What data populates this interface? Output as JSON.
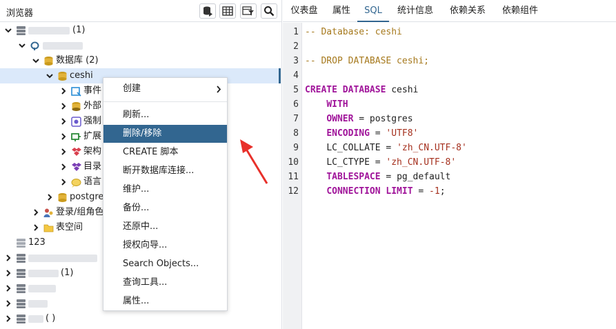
{
  "browser": {
    "title": "浏览器",
    "tree": {
      "server_group_suffix": "(1)",
      "databases_label": "数据库 (2)",
      "db_ceshi": "ceshi",
      "events": "事件",
      "foreign": "外部",
      "force": "强制",
      "extensions": "扩展",
      "schemas": "架构",
      "catalogs": "目录",
      "languages": "语言",
      "db_postgres": "postgres",
      "login_roles": "登录/组角色",
      "tablespaces": "表空间",
      "group_123": "123",
      "group_s_suffix": "(1)",
      "group_last_suffix": "( )"
    }
  },
  "context_menu": {
    "items": [
      {
        "label": "创建",
        "has_submenu": true
      },
      {
        "label": "刷新..."
      },
      {
        "label": "删除/移除",
        "active": true
      },
      {
        "label": "CREATE 脚本"
      },
      {
        "label": "断开数据库连接..."
      },
      {
        "label": "维护..."
      },
      {
        "label": "备份..."
      },
      {
        "label": "还原中..."
      },
      {
        "label": "授权向导..."
      },
      {
        "label": "Search Objects..."
      },
      {
        "label": "查询工具..."
      },
      {
        "label": "属性..."
      }
    ]
  },
  "tabs": [
    "仪表盘",
    "属性",
    "SQL",
    "统计信息",
    "依赖关系",
    "依赖组件"
  ],
  "active_tab": "SQL",
  "sql": {
    "line_numbers": [
      "1",
      "2",
      "3",
      "4",
      "5",
      "6",
      "7",
      "8",
      "9",
      "10",
      "11",
      "12"
    ],
    "l1": "-- Database: ceshi",
    "l3": "-- DROP DATABASE ceshi;",
    "l5_kw": "CREATE DATABASE",
    "l5_rest": " ceshi",
    "l6_kw": "WITH",
    "l7_kw": "OWNER",
    "l7_rest": " = postgres",
    "l8_kw": "ENCODING",
    "l8_eq": " = ",
    "l8_str": "'UTF8'",
    "l9_a": "LC_COLLATE = ",
    "l9_str": "'zh_CN.UTF-8'",
    "l10_a": "LC_CTYPE = ",
    "l10_str": "'zh_CN.UTF-8'",
    "l11_kw": "TABLESPACE",
    "l11_rest": " = pg_default",
    "l12_kw": "CONNECTION LIMIT",
    "l12_eq": " = ",
    "l12_num": "-1",
    "l12_end": ";"
  },
  "colors": {
    "accent": "#326690",
    "comment": "#a6791d",
    "keyword": "#a0149a",
    "string": "#a5301e",
    "selection": "#dbe9fa",
    "arrow": "#e8302a"
  }
}
